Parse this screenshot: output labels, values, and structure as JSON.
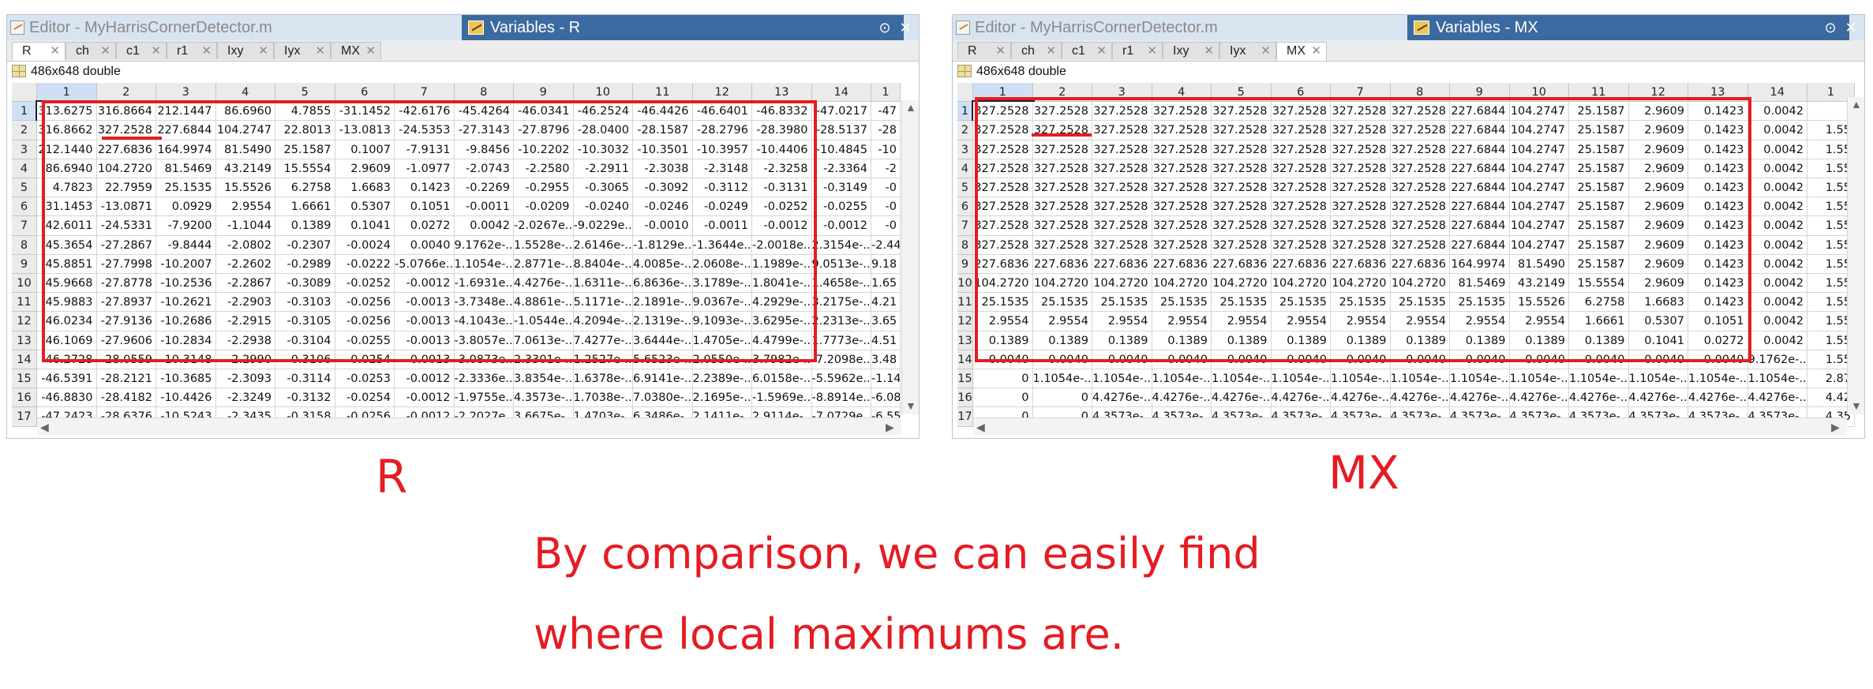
{
  "left": {
    "editor_title": "Editor - MyHarrisCornerDetector.m",
    "variables_title": "Variables - R",
    "tabs": [
      "R",
      "ch",
      "c1",
      "r1",
      "Ixy",
      "Iyx",
      "MX"
    ],
    "active_tab": 0,
    "dims": "486x648 double",
    "columns": [
      "1",
      "2",
      "3",
      "4",
      "5",
      "6",
      "7",
      "8",
      "9",
      "10",
      "11",
      "12",
      "13",
      "14",
      "1"
    ],
    "rows": [
      [
        "1",
        "313.6275",
        "316.8664",
        "212.1447",
        "86.6960",
        "4.7855",
        "-31.1452",
        "-42.6176",
        "-45.4264",
        "-46.0341",
        "-46.2524",
        "-46.4426",
        "-46.6401",
        "-46.8332",
        "-47.0217",
        "-47"
      ],
      [
        "2",
        "316.8662",
        "327.2528",
        "227.6844",
        "104.2747",
        "22.8013",
        "-13.0813",
        "-24.5353",
        "-27.3143",
        "-27.8796",
        "-28.0400",
        "-28.1587",
        "-28.2796",
        "-28.3980",
        "-28.5137",
        "-28"
      ],
      [
        "3",
        "212.1440",
        "227.6836",
        "164.9974",
        "81.5490",
        "25.1587",
        "0.1007",
        "-7.9131",
        "-9.8456",
        "-10.2202",
        "-10.3032",
        "-10.3501",
        "-10.3957",
        "-10.4406",
        "-10.4845",
        "-10"
      ],
      [
        "4",
        "86.6940",
        "104.2720",
        "81.5469",
        "43.2149",
        "15.5554",
        "2.9609",
        "-1.0977",
        "-2.0743",
        "-2.2580",
        "-2.2911",
        "-2.3038",
        "-2.3148",
        "-2.3258",
        "-2.3364",
        "-2"
      ],
      [
        "5",
        "4.7823",
        "22.7959",
        "25.1535",
        "15.5526",
        "6.2758",
        "1.6683",
        "0.1423",
        "-0.2269",
        "-0.2955",
        "-0.3065",
        "-0.3092",
        "-0.3112",
        "-0.3131",
        "-0.3149",
        "-0"
      ],
      [
        "6",
        "-31.1453",
        "-13.0871",
        "0.0929",
        "2.9554",
        "1.6661",
        "0.5307",
        "0.1051",
        "-0.0011",
        "-0.0209",
        "-0.0240",
        "-0.0246",
        "-0.0249",
        "-0.0252",
        "-0.0255",
        "-0"
      ],
      [
        "7",
        "-42.6011",
        "-24.5331",
        "-7.9200",
        "-1.1044",
        "0.1389",
        "0.1041",
        "0.0272",
        "0.0042",
        "-2.0267e...",
        "-9.0229e...",
        "-0.0010",
        "-0.0011",
        "-0.0012",
        "-0.0012",
        "-0"
      ],
      [
        "8",
        "-45.3654",
        "-27.2867",
        "-9.8444",
        "-2.0802",
        "-0.2307",
        "-0.0024",
        "0.0040",
        "9.1762e-...",
        "1.5528e-...",
        "2.6146e-...",
        "-1.8129e...",
        "-1.3644e...",
        "-2.0018e...",
        "2.3154e-...",
        "-2.44"
      ],
      [
        "9",
        "-45.8851",
        "-27.7998",
        "-10.2007",
        "-2.2602",
        "-0.2989",
        "-0.0222",
        "-5.0766e...",
        "1.1054e-...",
        "2.8771e-...",
        "8.8404e-...",
        "4.0085e-...",
        "2.0608e-...",
        "1.1989e-...",
        "9.0513e-...",
        "9.18"
      ],
      [
        "10",
        "-45.9668",
        "-27.8778",
        "-10.2536",
        "-2.2867",
        "-0.3089",
        "-0.0252",
        "-0.0012",
        "-1.6931e...",
        "4.4276e-...",
        "1.6311e-...",
        "6.8636e-...",
        "3.1789e-...",
        "1.8041e-...",
        "1.4658e-...",
        "1.65"
      ],
      [
        "11",
        "-45.9883",
        "-27.8937",
        "-10.2621",
        "-2.2903",
        "-0.3103",
        "-0.0256",
        "-0.0013",
        "-3.7348e...",
        "4.8861e-...",
        "5.1171e-...",
        "2.1891e-...",
        "9.0367e-...",
        "4.2929e-...",
        "3.2175e-...",
        "4.21"
      ],
      [
        "12",
        "-46.0234",
        "-27.9136",
        "-10.2686",
        "-2.2915",
        "-0.3105",
        "-0.0256",
        "-0.0013",
        "-4.1043e...",
        "-1.0544e...",
        "4.2094e-...",
        "2.1319e-...",
        "9.1093e-...",
        "3.6295e-...",
        "2.2313e-...",
        "3.65"
      ],
      [
        "13",
        "-46.1069",
        "-27.9606",
        "-10.2834",
        "-2.2938",
        "-0.3104",
        "-0.0255",
        "-0.0013",
        "-3.8057e...",
        "7.0613e-...",
        "7.4277e-...",
        "3.6444e-...",
        "1.4705e-...",
        "4.4799e-...",
        "1.7773e-...",
        "4.51"
      ],
      [
        "14",
        "-46.2728",
        "-28.0559",
        "-10.3148",
        "-2.2990",
        "-0.3106",
        "-0.0254",
        "-0.0013",
        "-3.0873e...",
        "2.3301e-...",
        "1.2527e-...",
        "5.6523e-...",
        "2.0550e-...",
        "3.7982e-...",
        "-7.2098e...",
        "3.48"
      ],
      [
        "15",
        "-46.5391",
        "-28.2121",
        "-10.3685",
        "-2.3093",
        "-0.3114",
        "-0.0253",
        "-0.0012",
        "-2.3336e...",
        "3.8354e-...",
        "1.6378e-...",
        "6.9141e-...",
        "2.2389e-...",
        "6.0158e-...",
        "-5.5962e...",
        "-1.14"
      ],
      [
        "16",
        "-46.8830",
        "-28.4182",
        "-10.4426",
        "-2.3249",
        "-0.3132",
        "-0.0254",
        "-0.0012",
        "-1.9755e...",
        "4.3573e-...",
        "1.7038e-...",
        "7.0380e-...",
        "2.1695e-...",
        "-1.5969e...",
        "-8.8914e...",
        "-6.08"
      ],
      [
        "17",
        "-47.2423",
        "-28.6376",
        "-10.5243",
        "-2.3435",
        "-0.3158",
        "-0.0256",
        "-0.0012",
        "-2.2027e...",
        "3.6675e-...",
        "1.4703e-...",
        "6.3486e-...",
        "2.1411e-...",
        "2.9114e-...",
        "-7.0729e...",
        "-6.55"
      ]
    ],
    "label": "R"
  },
  "right": {
    "editor_title": "Editor - MyHarrisCornerDetector.m",
    "variables_title": "Variables - MX",
    "tabs": [
      "R",
      "ch",
      "c1",
      "r1",
      "Ixy",
      "Iyx",
      "MX"
    ],
    "active_tab": 6,
    "dims": "486x648 double",
    "columns": [
      "1",
      "2",
      "3",
      "4",
      "5",
      "6",
      "7",
      "8",
      "9",
      "10",
      "11",
      "12",
      "13",
      "14",
      "1"
    ],
    "rows": [
      [
        "1",
        "327.2528",
        "327.2528",
        "327.2528",
        "327.2528",
        "327.2528",
        "327.2528",
        "327.2528",
        "327.2528",
        "227.6844",
        "104.2747",
        "25.1587",
        "2.9609",
        "0.1423",
        "0.0042",
        ""
      ],
      [
        "2",
        "327.2528",
        "327.2528",
        "327.2528",
        "327.2528",
        "327.2528",
        "327.2528",
        "327.2528",
        "327.2528",
        "227.6844",
        "104.2747",
        "25.1587",
        "2.9609",
        "0.1423",
        "0.0042",
        "1.55"
      ],
      [
        "3",
        "327.2528",
        "327.2528",
        "327.2528",
        "327.2528",
        "327.2528",
        "327.2528",
        "327.2528",
        "327.2528",
        "227.6844",
        "104.2747",
        "25.1587",
        "2.9609",
        "0.1423",
        "0.0042",
        "1.55"
      ],
      [
        "4",
        "327.2528",
        "327.2528",
        "327.2528",
        "327.2528",
        "327.2528",
        "327.2528",
        "327.2528",
        "327.2528",
        "227.6844",
        "104.2747",
        "25.1587",
        "2.9609",
        "0.1423",
        "0.0042",
        "1.55"
      ],
      [
        "5",
        "327.2528",
        "327.2528",
        "327.2528",
        "327.2528",
        "327.2528",
        "327.2528",
        "327.2528",
        "327.2528",
        "227.6844",
        "104.2747",
        "25.1587",
        "2.9609",
        "0.1423",
        "0.0042",
        "1.55"
      ],
      [
        "6",
        "327.2528",
        "327.2528",
        "327.2528",
        "327.2528",
        "327.2528",
        "327.2528",
        "327.2528",
        "327.2528",
        "227.6844",
        "104.2747",
        "25.1587",
        "2.9609",
        "0.1423",
        "0.0042",
        "1.55"
      ],
      [
        "7",
        "327.2528",
        "327.2528",
        "327.2528",
        "327.2528",
        "327.2528",
        "327.2528",
        "327.2528",
        "327.2528",
        "227.6844",
        "104.2747",
        "25.1587",
        "2.9609",
        "0.1423",
        "0.0042",
        "1.55"
      ],
      [
        "8",
        "327.2528",
        "327.2528",
        "327.2528",
        "327.2528",
        "327.2528",
        "327.2528",
        "327.2528",
        "327.2528",
        "227.6844",
        "104.2747",
        "25.1587",
        "2.9609",
        "0.1423",
        "0.0042",
        "1.55"
      ],
      [
        "9",
        "227.6836",
        "227.6836",
        "227.6836",
        "227.6836",
        "227.6836",
        "227.6836",
        "227.6836",
        "227.6836",
        "164.9974",
        "81.5490",
        "25.1587",
        "2.9609",
        "0.1423",
        "0.0042",
        "1.55"
      ],
      [
        "10",
        "104.2720",
        "104.2720",
        "104.2720",
        "104.2720",
        "104.2720",
        "104.2720",
        "104.2720",
        "104.2720",
        "81.5469",
        "43.2149",
        "15.5554",
        "2.9609",
        "0.1423",
        "0.0042",
        "1.55"
      ],
      [
        "11",
        "25.1535",
        "25.1535",
        "25.1535",
        "25.1535",
        "25.1535",
        "25.1535",
        "25.1535",
        "25.1535",
        "25.1535",
        "15.5526",
        "6.2758",
        "1.6683",
        "0.1423",
        "0.0042",
        "1.55"
      ],
      [
        "12",
        "2.9554",
        "2.9554",
        "2.9554",
        "2.9554",
        "2.9554",
        "2.9554",
        "2.9554",
        "2.9554",
        "2.9554",
        "2.9554",
        "1.6661",
        "0.5307",
        "0.1051",
        "0.0042",
        "1.55"
      ],
      [
        "13",
        "0.1389",
        "0.1389",
        "0.1389",
        "0.1389",
        "0.1389",
        "0.1389",
        "0.1389",
        "0.1389",
        "0.1389",
        "0.1389",
        "0.1389",
        "0.1041",
        "0.0272",
        "0.0042",
        "1.55"
      ],
      [
        "14",
        "0.0040",
        "0.0040",
        "0.0040",
        "0.0040",
        "0.0040",
        "0.0040",
        "0.0040",
        "0.0040",
        "0.0040",
        "0.0040",
        "0.0040",
        "0.0040",
        "0.0040",
        "9.1762e-...",
        "1.55"
      ],
      [
        "15",
        "0",
        "1.1054e-...",
        "1.1054e-...",
        "1.1054e-...",
        "1.1054e-...",
        "1.1054e-...",
        "1.1054e-...",
        "1.1054e-...",
        "1.1054e-...",
        "1.1054e-...",
        "1.1054e-...",
        "1.1054e-...",
        "1.1054e-...",
        "1.1054e-...",
        "2.87"
      ],
      [
        "16",
        "0",
        "0",
        "4.4276e-...",
        "4.4276e-...",
        "4.4276e-...",
        "4.4276e-...",
        "4.4276e-...",
        "4.4276e-...",
        "4.4276e-...",
        "4.4276e-...",
        "4.4276e-...",
        "4.4276e-...",
        "4.4276e-...",
        "4.4276e-...",
        "4.42"
      ],
      [
        "17",
        "0",
        "0",
        "4.3573e-...",
        "4.3573e-...",
        "4.3573e-...",
        "4.3573e-...",
        "4.3573e-...",
        "4.3573e-...",
        "4.3573e-...",
        "4.3573e-...",
        "4.3573e-...",
        "4.3573e-...",
        "4.3573e-...",
        "4.3573e-...",
        "4.35"
      ]
    ],
    "label": "MX"
  },
  "caption": {
    "line1": "By comparison, we can easily find",
    "line2": "where local maximums are."
  },
  "colors": {
    "accent_red": "#e51c23",
    "title_blue": "#3b6aa0"
  }
}
